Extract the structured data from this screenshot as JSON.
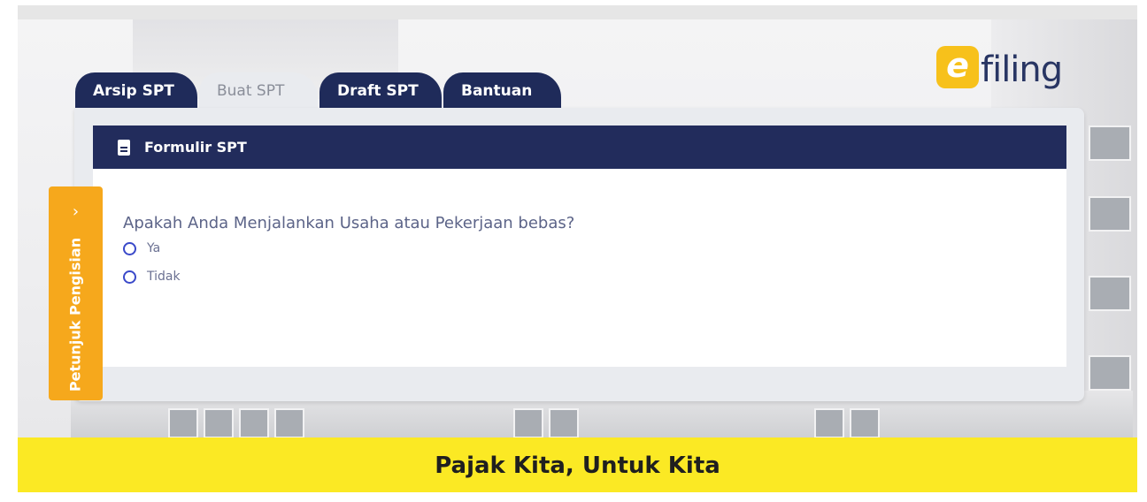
{
  "tabs": [
    {
      "label": "Arsip SPT",
      "state": "inactive"
    },
    {
      "label": "Buat SPT",
      "state": "active"
    },
    {
      "label": "Draft SPT",
      "state": "inactive"
    },
    {
      "label": "Bantuan",
      "state": "inactive"
    }
  ],
  "logo": {
    "mark": "e",
    "text": "filing"
  },
  "card": {
    "icon": "document-icon",
    "title": "Formulir SPT"
  },
  "form": {
    "question": "Apakah Anda Menjalankan Usaha atau Pekerjaan bebas?",
    "options": [
      "Ya",
      "Tidak"
    ],
    "selected": null
  },
  "side_tab": {
    "label": "Petunjuk Pengisian",
    "icon": "chevron-right-icon"
  },
  "footer": {
    "tagline": "Pajak Kita, Untuk Kita"
  },
  "colors": {
    "navy": "#222c5c",
    "yellow": "#fbe924",
    "orange": "#f6a81c",
    "radio_blue": "#3a49c9"
  }
}
